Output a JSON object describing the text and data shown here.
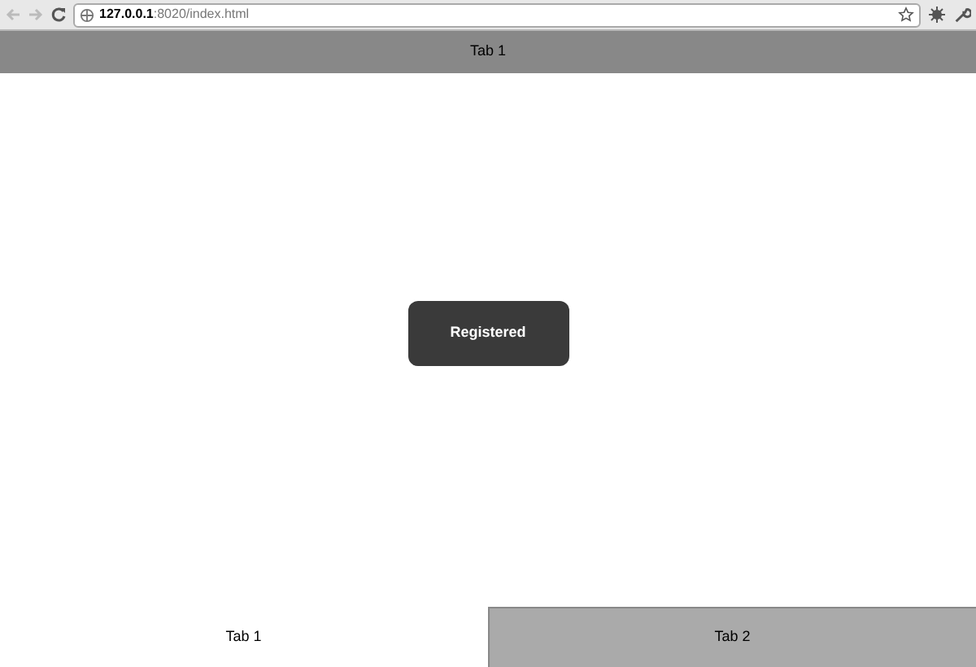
{
  "browser": {
    "url_host": "127.0.0.1",
    "url_rest": ":8020/index.html"
  },
  "title_bar": {
    "title": "Tab 1"
  },
  "toast": {
    "text": "Registered"
  },
  "tabs": [
    {
      "label": "Tab 1",
      "selected": true
    },
    {
      "label": "Tab 2",
      "selected": false
    }
  ]
}
